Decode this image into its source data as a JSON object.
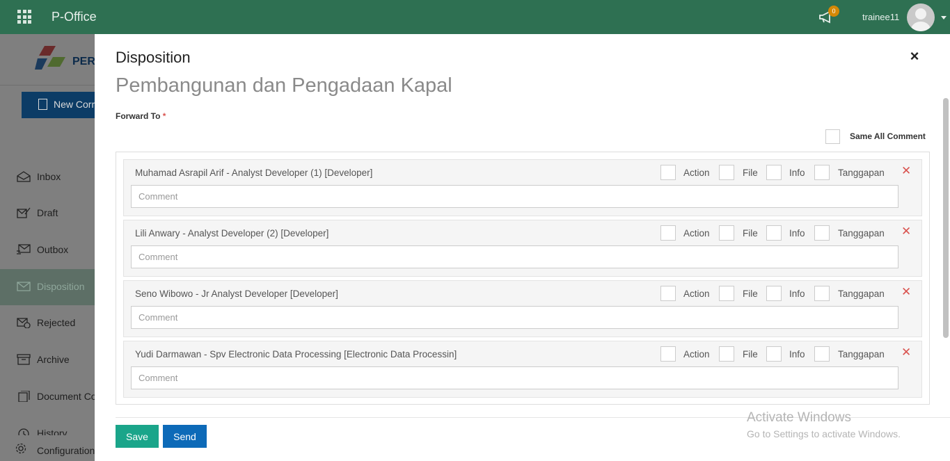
{
  "topbar": {
    "app_title": "P-Office",
    "notification_count": "0",
    "username": "trainee11"
  },
  "sidebar": {
    "logo_text": "PER",
    "new_button_label": "New Corre",
    "items": [
      {
        "label": "Inbox",
        "icon": "inbox-icon"
      },
      {
        "label": "Draft",
        "icon": "draft-icon"
      },
      {
        "label": "Outbox",
        "icon": "outbox-icon"
      },
      {
        "label": "Disposition",
        "icon": "disposition-icon",
        "active": true
      },
      {
        "label": "Rejected",
        "icon": "rejected-icon"
      },
      {
        "label": "Archive",
        "icon": "archive-icon"
      },
      {
        "label": "Document Co",
        "icon": "document-icon"
      },
      {
        "label": "History",
        "icon": "history-icon"
      },
      {
        "label": "Configuration",
        "icon": "gear-icon"
      }
    ]
  },
  "modal": {
    "title": "Disposition",
    "close_symbol": "×",
    "subtitle": "Pembangunan dan Pengadaan Kapal",
    "forward_label": "Forward To",
    "required_mark": "*",
    "same_all_comment_label": "Same All Comment",
    "option_labels": [
      "Action",
      "File",
      "Info",
      "Tanggapan"
    ],
    "comment_placeholder": "Comment",
    "recipients": [
      {
        "name": "Muhamad Asrapil Arif - Analyst Developer (1) [Developer]"
      },
      {
        "name": "Lili Anwary - Analyst Developer (2) [Developer]"
      },
      {
        "name": "Seno Wibowo - Jr Analyst Developer [Developer]"
      },
      {
        "name": "Yudi Darmawan - Spv Electronic Data Processing [Electronic Data Processin]"
      }
    ],
    "remove_symbol": "✕",
    "save_label": "Save",
    "send_label": "Send"
  },
  "watermark": {
    "line1": "Activate Windows",
    "line2": "Go to Settings to activate Windows."
  },
  "colors": {
    "topbar": "#2e7052",
    "save": "#1aa58a",
    "send": "#0d6ab8",
    "remove": "#d9534f"
  }
}
